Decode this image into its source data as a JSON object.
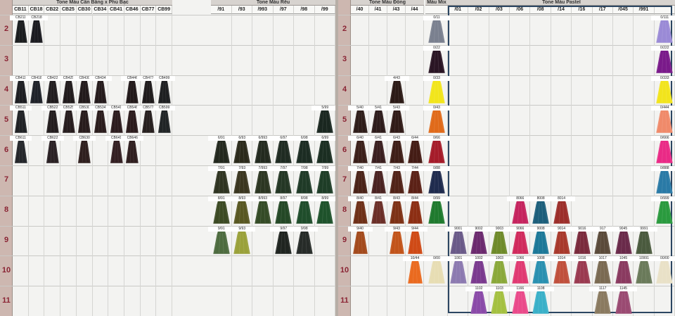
{
  "groups": [
    {
      "title": "Tone Màu Cân Bằng x Phủ Bạc",
      "cols": [
        "CB11",
        "CB18",
        "CB22",
        "CB25",
        "CB30",
        "CB34",
        "CB41",
        "CB46",
        "CB77",
        "CB99"
      ]
    },
    {
      "title": "Tone Màu Rêu",
      "cols": [
        "/91",
        "/93",
        "/993",
        "/97",
        "/98",
        "/99"
      ]
    },
    {
      "title": "Tone Màu Đồng",
      "cols": [
        "/40",
        "/41",
        "/43",
        "/44"
      ]
    },
    {
      "title": "Màu Mix",
      "cols": [
        ""
      ]
    },
    {
      "title": "Tone Màu Pastel",
      "cols": [
        "/01",
        "/02",
        "/03",
        "/06",
        "/08",
        "/14",
        "/16",
        "/17",
        "/045",
        "/991",
        ""
      ]
    }
  ],
  "rows": [
    "2",
    "3",
    "4",
    "5",
    "6",
    "7",
    "8",
    "9",
    "10",
    "11"
  ],
  "swatches": [
    {
      "g": 0,
      "c": 0,
      "r": 2,
      "code": "CB211",
      "color": "#1a1c1e"
    },
    {
      "g": 0,
      "c": 1,
      "r": 2,
      "code": "CB218",
      "color": "#1b1b20"
    },
    {
      "g": 0,
      "c": 0,
      "r": 4,
      "code": "CB411",
      "color": "#1d1e22"
    },
    {
      "g": 0,
      "c": 1,
      "r": 4,
      "code": "CB418",
      "color": "#1f2229"
    },
    {
      "g": 0,
      "c": 2,
      "r": 4,
      "code": "CB422",
      "color": "#211d1f"
    },
    {
      "g": 0,
      "c": 3,
      "r": 4,
      "code": "CB425",
      "color": "#211b1c"
    },
    {
      "g": 0,
      "c": 4,
      "r": 4,
      "code": "CB430",
      "color": "#221a1b"
    },
    {
      "g": 0,
      "c": 5,
      "r": 4,
      "code": "CB434",
      "color": "#251b1c"
    },
    {
      "g": 0,
      "c": 7,
      "r": 4,
      "code": "CB446",
      "color": "#22191a"
    },
    {
      "g": 0,
      "c": 8,
      "r": 4,
      "code": "CB477",
      "color": "#1f1b1c"
    },
    {
      "g": 0,
      "c": 9,
      "r": 4,
      "code": "CB499",
      "color": "#1e1f21"
    },
    {
      "g": 0,
      "c": 0,
      "r": 5,
      "code": "CB511",
      "color": "#1f2124"
    },
    {
      "g": 0,
      "c": 2,
      "r": 5,
      "code": "CB522",
      "color": "#231d1e"
    },
    {
      "g": 0,
      "c": 3,
      "r": 5,
      "code": "CB525",
      "color": "#261c1d"
    },
    {
      "g": 0,
      "c": 4,
      "r": 5,
      "code": "CB530",
      "color": "#281c1c"
    },
    {
      "g": 0,
      "c": 5,
      "r": 5,
      "code": "CB534",
      "color": "#2a1c1c"
    },
    {
      "g": 0,
      "c": 6,
      "r": 5,
      "code": "CB541",
      "color": "#2c1c1e"
    },
    {
      "g": 0,
      "c": 7,
      "r": 5,
      "code": "CB546",
      "color": "#2b1b1c"
    },
    {
      "g": 0,
      "c": 8,
      "r": 5,
      "code": "CB577",
      "color": "#261f1e"
    },
    {
      "g": 0,
      "c": 9,
      "r": 5,
      "code": "CB599",
      "color": "#202426"
    },
    {
      "g": 0,
      "c": 0,
      "r": 6,
      "code": "CB611",
      "color": "#24262a"
    },
    {
      "g": 0,
      "c": 2,
      "r": 6,
      "code": "CB622",
      "color": "#2a2124"
    },
    {
      "g": 0,
      "c": 4,
      "r": 6,
      "code": "CB630",
      "color": "#2f1f1e"
    },
    {
      "g": 0,
      "c": 6,
      "r": 6,
      "code": "CB641",
      "color": "#331f22"
    },
    {
      "g": 0,
      "c": 7,
      "r": 6,
      "code": "CB646",
      "color": "#2f1e1f"
    },
    {
      "g": 1,
      "c": 0,
      "r": 6,
      "code": "6/91",
      "color": "#23281e"
    },
    {
      "g": 1,
      "c": 1,
      "r": 6,
      "code": "6/93",
      "color": "#2b2a1b"
    },
    {
      "g": 1,
      "c": 2,
      "r": 6,
      "code": "6/993",
      "color": "#232a1f"
    },
    {
      "g": 1,
      "c": 3,
      "r": 6,
      "code": "6/97",
      "color": "#1f2b22"
    },
    {
      "g": 1,
      "c": 4,
      "r": 6,
      "code": "6/98",
      "color": "#1c2c23"
    },
    {
      "g": 1,
      "c": 5,
      "r": 6,
      "code": "6/99",
      "color": "#1b2e22"
    },
    {
      "g": 1,
      "c": 5,
      "r": 5,
      "code": "5/99",
      "color": "#1a2720"
    },
    {
      "g": 1,
      "c": 0,
      "r": 7,
      "code": "7/91",
      "color": "#2f3422"
    },
    {
      "g": 1,
      "c": 1,
      "r": 7,
      "code": "7/93",
      "color": "#3a3620"
    },
    {
      "g": 1,
      "c": 2,
      "r": 7,
      "code": "7/993",
      "color": "#2c3622"
    },
    {
      "g": 1,
      "c": 3,
      "r": 7,
      "code": "7/97",
      "color": "#243725"
    },
    {
      "g": 1,
      "c": 4,
      "r": 7,
      "code": "7/98",
      "color": "#1f3a27"
    },
    {
      "g": 1,
      "c": 5,
      "r": 7,
      "code": "7/99",
      "color": "#1e3d27"
    },
    {
      "g": 1,
      "c": 0,
      "r": 8,
      "code": "8/91",
      "color": "#3c4a24"
    },
    {
      "g": 1,
      "c": 1,
      "r": 8,
      "code": "8/93",
      "color": "#585722"
    },
    {
      "g": 1,
      "c": 2,
      "r": 8,
      "code": "8/993",
      "color": "#344b26"
    },
    {
      "g": 1,
      "c": 3,
      "r": 8,
      "code": "8/97",
      "color": "#244826"
    },
    {
      "g": 1,
      "c": 4,
      "r": 8,
      "code": "8/98",
      "color": "#1f4d2b"
    },
    {
      "g": 1,
      "c": 5,
      "r": 8,
      "code": "8/99",
      "color": "#1e522b"
    },
    {
      "g": 1,
      "c": 0,
      "r": 9,
      "code": "9/91",
      "color": "#4d6b3f"
    },
    {
      "g": 1,
      "c": 1,
      "r": 9,
      "code": "9/93",
      "color": "#9aa13a"
    },
    {
      "g": 1,
      "c": 3,
      "r": 9,
      "code": "9/97",
      "color": "#1f2420"
    },
    {
      "g": 1,
      "c": 4,
      "r": 9,
      "code": "9/98",
      "color": "#262b28"
    },
    {
      "g": 2,
      "c": 2,
      "r": 4,
      "code": "4/43",
      "color": "#2b1a16"
    },
    {
      "g": 2,
      "c": 0,
      "r": 5,
      "code": "5/40",
      "color": "#2e1d19"
    },
    {
      "g": 2,
      "c": 1,
      "r": 5,
      "code": "5/41",
      "color": "#2d1c1b"
    },
    {
      "g": 2,
      "c": 2,
      "r": 5,
      "code": "5/43",
      "color": "#301b17"
    },
    {
      "g": 2,
      "c": 0,
      "r": 6,
      "code": "6/40",
      "color": "#3a1f19"
    },
    {
      "g": 2,
      "c": 1,
      "r": 6,
      "code": "6/41",
      "color": "#3a1f1f"
    },
    {
      "g": 2,
      "c": 2,
      "r": 6,
      "code": "6/43",
      "color": "#3e1e17"
    },
    {
      "g": 2,
      "c": 3,
      "r": 6,
      "code": "6/44",
      "color": "#441c15"
    },
    {
      "g": 2,
      "c": 0,
      "r": 7,
      "code": "7/40",
      "color": "#4a2318"
    },
    {
      "g": 2,
      "c": 1,
      "r": 7,
      "code": "7/41",
      "color": "#4a2321"
    },
    {
      "g": 2,
      "c": 2,
      "r": 7,
      "code": "7/43",
      "color": "#512318"
    },
    {
      "g": 2,
      "c": 3,
      "r": 7,
      "code": "7/44",
      "color": "#5b2116"
    },
    {
      "g": 2,
      "c": 0,
      "r": 8,
      "code": "8/40",
      "color": "#6e3018"
    },
    {
      "g": 2,
      "c": 1,
      "r": 8,
      "code": "8/41",
      "color": "#6b2f28"
    },
    {
      "g": 2,
      "c": 2,
      "r": 8,
      "code": "8/43",
      "color": "#7d3115"
    },
    {
      "g": 2,
      "c": 3,
      "r": 8,
      "code": "8/44",
      "color": "#8c2e13"
    },
    {
      "g": 2,
      "c": 0,
      "r": 9,
      "code": "9/40",
      "color": "#a34a1c"
    },
    {
      "g": 2,
      "c": 2,
      "r": 9,
      "code": "9/43",
      "color": "#c2541a"
    },
    {
      "g": 2,
      "c": 3,
      "r": 9,
      "code": "9/44",
      "color": "#cf4a16"
    },
    {
      "g": 2,
      "c": 3,
      "r": 10,
      "code": "10/44",
      "color": "#ea6a1f"
    },
    {
      "g": 3,
      "c": 0,
      "r": 2,
      "code": "0/11",
      "color": "#7a808f"
    },
    {
      "g": 3,
      "c": 0,
      "r": 3,
      "code": "0/22",
      "color": "#2a1524"
    },
    {
      "g": 3,
      "c": 0,
      "r": 4,
      "code": "0/33",
      "color": "#f2e51b"
    },
    {
      "g": 3,
      "c": 0,
      "r": 5,
      "code": "0/43",
      "color": "#e06a1a"
    },
    {
      "g": 3,
      "c": 0,
      "r": 6,
      "code": "0/66",
      "color": "#a51c2a"
    },
    {
      "g": 3,
      "c": 0,
      "r": 7,
      "code": "0/88",
      "color": "#1f2b4e"
    },
    {
      "g": 3,
      "c": 0,
      "r": 8,
      "code": "0/99",
      "color": "#1f7a2e"
    },
    {
      "g": 3,
      "c": 0,
      "r": 10,
      "code": "0/00",
      "color": "#e7ddb3"
    },
    {
      "g": 4,
      "c": 3,
      "r": 8,
      "code": "8066",
      "color": "#c5245e"
    },
    {
      "g": 4,
      "c": 4,
      "r": 8,
      "code": "8008",
      "color": "#1c5e7a"
    },
    {
      "g": 4,
      "c": 5,
      "r": 8,
      "code": "8014",
      "color": "#9c2e2a"
    },
    {
      "g": 4,
      "c": 0,
      "r": 9,
      "code": "9001",
      "color": "#6a5a88"
    },
    {
      "g": 4,
      "c": 1,
      "r": 9,
      "code": "9002",
      "color": "#6b2a6e"
    },
    {
      "g": 4,
      "c": 2,
      "r": 9,
      "code": "9003",
      "color": "#6f8a2a"
    },
    {
      "g": 4,
      "c": 3,
      "r": 9,
      "code": "9066",
      "color": "#d02a5c"
    },
    {
      "g": 4,
      "c": 4,
      "r": 9,
      "code": "9008",
      "color": "#1c7898"
    },
    {
      "g": 4,
      "c": 5,
      "r": 9,
      "code": "9014",
      "color": "#a8392c"
    },
    {
      "g": 4,
      "c": 6,
      "r": 9,
      "code": "9016",
      "color": "#7a2a3c"
    },
    {
      "g": 4,
      "c": 7,
      "r": 9,
      "code": "917",
      "color": "#5a4a3a"
    },
    {
      "g": 4,
      "c": 8,
      "r": 9,
      "code": "9045",
      "color": "#6a2a4a"
    },
    {
      "g": 4,
      "c": 9,
      "r": 9,
      "code": "9991",
      "color": "#4a5a3e"
    },
    {
      "g": 4,
      "c": 0,
      "r": 10,
      "code": "1001",
      "color": "#8c7ab0"
    },
    {
      "g": 4,
      "c": 1,
      "r": 10,
      "code": "1002",
      "color": "#7a3a8e"
    },
    {
      "g": 4,
      "c": 2,
      "r": 10,
      "code": "1003",
      "color": "#8aa83a"
    },
    {
      "g": 4,
      "c": 3,
      "r": 10,
      "code": "1066",
      "color": "#e03a72"
    },
    {
      "g": 4,
      "c": 4,
      "r": 10,
      "code": "1008",
      "color": "#2a90b0"
    },
    {
      "g": 4,
      "c": 5,
      "r": 10,
      "code": "1014",
      "color": "#c0503c"
    },
    {
      "g": 4,
      "c": 6,
      "r": 10,
      "code": "1016",
      "color": "#9a3a50"
    },
    {
      "g": 4,
      "c": 7,
      "r": 10,
      "code": "1017",
      "color": "#7a6a52"
    },
    {
      "g": 4,
      "c": 8,
      "r": 10,
      "code": "1045",
      "color": "#8a3a60"
    },
    {
      "g": 4,
      "c": 9,
      "r": 10,
      "code": "10991",
      "color": "#6a7a5a"
    },
    {
      "g": 4,
      "c": 10,
      "r": 10,
      "code": "00/00",
      "color": "#e9e1c7"
    },
    {
      "g": 4,
      "c": 1,
      "r": 11,
      "code": "1102",
      "color": "#8a4aa8"
    },
    {
      "g": 4,
      "c": 2,
      "r": 11,
      "code": "1103",
      "color": "#a4c040"
    },
    {
      "g": 4,
      "c": 3,
      "r": 11,
      "code": "1166",
      "color": "#ea4a8a"
    },
    {
      "g": 4,
      "c": 4,
      "r": 11,
      "code": "1108",
      "color": "#3ab0c8"
    },
    {
      "g": 4,
      "c": 7,
      "r": 11,
      "code": "1117",
      "color": "#8a7a60"
    },
    {
      "g": 4,
      "c": 8,
      "r": 11,
      "code": "1145",
      "color": "#9a4a72"
    },
    {
      "g": 4,
      "c": 10,
      "r": 2,
      "code": "0/111",
      "color": "#9a8ad6"
    },
    {
      "g": 4,
      "c": 10,
      "r": 3,
      "code": "0/222",
      "color": "#7a1a8a"
    },
    {
      "g": 4,
      "c": 10,
      "r": 4,
      "code": "0/333",
      "color": "#f2e41c"
    },
    {
      "g": 4,
      "c": 10,
      "r": 5,
      "code": "0/444",
      "color": "#f08a6a"
    },
    {
      "g": 4,
      "c": 10,
      "r": 6,
      "code": "0/666",
      "color": "#ea2a86"
    },
    {
      "g": 4,
      "c": 10,
      "r": 7,
      "code": "0/888",
      "color": "#2a7aa6"
    },
    {
      "g": 4,
      "c": 10,
      "r": 8,
      "code": "0/999",
      "color": "#2a9a3e"
    }
  ]
}
